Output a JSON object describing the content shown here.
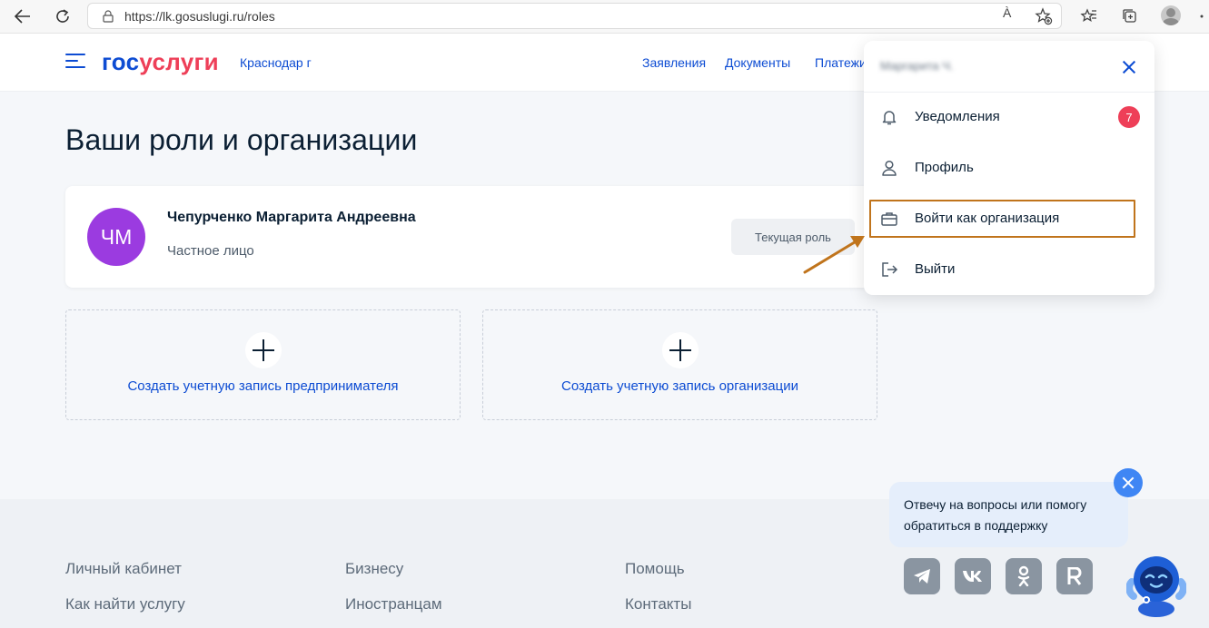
{
  "browser": {
    "url": "https://lk.gosuslugi.ru/roles",
    "read_aloud_glyph": "À"
  },
  "header": {
    "logo_part1": "гос",
    "logo_part2": "услуги",
    "region": "Краснодар г",
    "nav": [
      "Заявления",
      "Документы",
      "Платежи"
    ]
  },
  "main": {
    "title": "Ваши роли и организации",
    "role": {
      "initials": "ЧМ",
      "name": "Чепурченко Маргарита Андреевна",
      "type": "Частное лицо",
      "current_label": "Текущая роль"
    },
    "create_cards": [
      "Создать учетную запись предпринимателя",
      "Создать учетную запись организации"
    ]
  },
  "menu": {
    "user_name": "Маргарита Ч.",
    "items": [
      {
        "label": "Уведомления",
        "icon": "bell-icon"
      },
      {
        "label": "Профиль",
        "icon": "user-icon"
      },
      {
        "label": "Войти как организация",
        "icon": "briefcase-icon"
      },
      {
        "label": "Выйти",
        "icon": "logout-icon"
      }
    ],
    "notifications_badge": "7"
  },
  "footer": {
    "col1": [
      "Личный кабинет",
      "Как найти услугу"
    ],
    "col2": [
      "Бизнесу",
      "Иностранцам"
    ],
    "col3": [
      "Помощь",
      "Контакты"
    ]
  },
  "chat": {
    "message": "Отвечу на вопросы или помогу обратиться в поддержку",
    "socials": [
      "telegram-icon",
      "vk-icon",
      "odnoklassniki-icon",
      "rutube-icon"
    ]
  },
  "colors": {
    "brand_blue": "#0d4cd3",
    "brand_red": "#ee3f58",
    "avatar_purple": "#9b3be0",
    "highlight": "#c0741c"
  }
}
